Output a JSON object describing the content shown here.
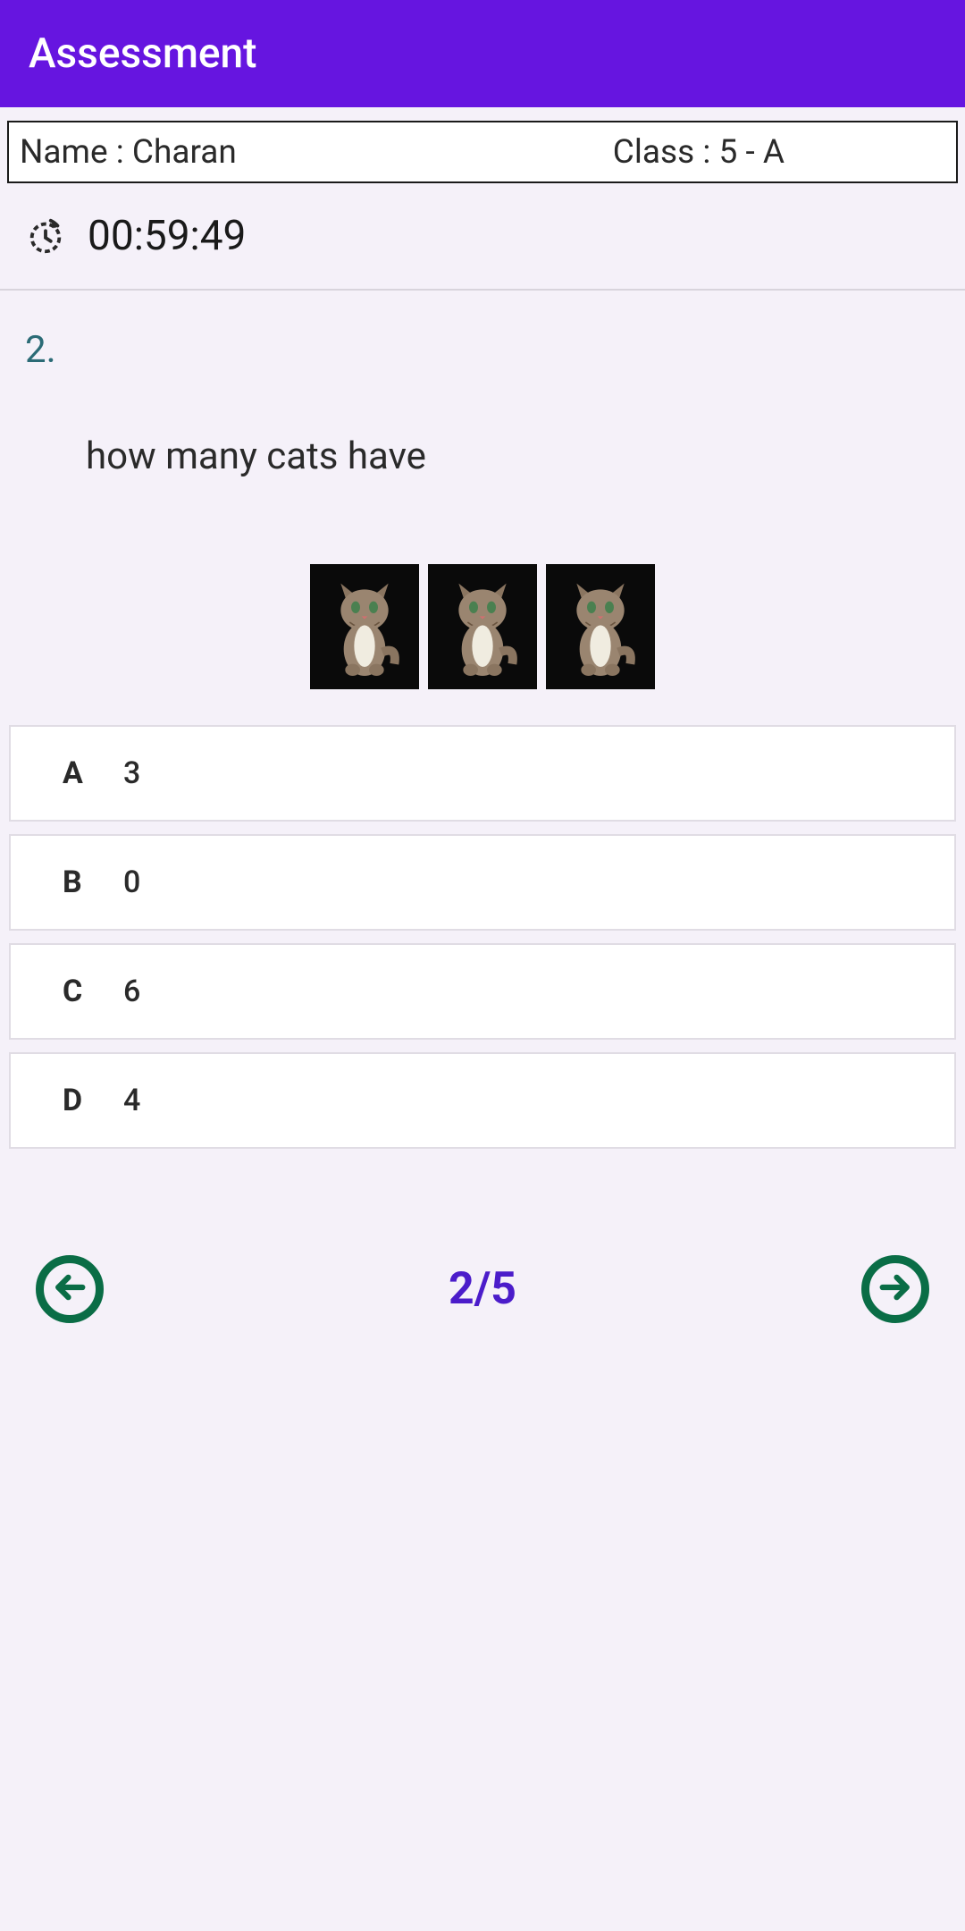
{
  "header": {
    "title": "Assessment"
  },
  "student": {
    "name_label": "Name : Charan",
    "class_label": "Class : 5 - A"
  },
  "timer": {
    "value": "00:59:49"
  },
  "question": {
    "number": "2.",
    "text": "how many cats have",
    "image_count": 3,
    "image_type": "cat"
  },
  "answers": [
    {
      "letter": "A",
      "value": "3"
    },
    {
      "letter": "B",
      "value": "0"
    },
    {
      "letter": "C",
      "value": "6"
    },
    {
      "letter": "D",
      "value": "4"
    }
  ],
  "pagination": {
    "display": "2/5"
  }
}
